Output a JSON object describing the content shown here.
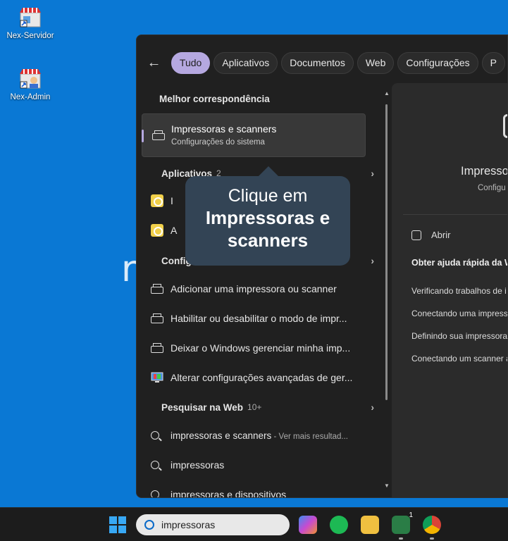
{
  "desktop": {
    "icons": [
      {
        "label": "Nex-Servidor"
      },
      {
        "label": "Nex-Admin"
      }
    ],
    "bg_letter": "r"
  },
  "search_panel": {
    "filters": [
      {
        "label": "Tudo",
        "active": true
      },
      {
        "label": "Aplicativos"
      },
      {
        "label": "Documentos"
      },
      {
        "label": "Web"
      },
      {
        "label": "Configurações"
      },
      {
        "label": "P"
      }
    ],
    "best_match": {
      "section": "Melhor correspondência",
      "title": "Impressoras e scanners",
      "subtitle": "Configurações do sistema"
    },
    "apps": {
      "section": "Aplicativos",
      "count": "2",
      "items": [
        "I",
        "A"
      ]
    },
    "settings": {
      "section": "Config",
      "items": [
        "Adicionar uma impressora ou scanner",
        "Habilitar ou desabilitar o modo de impr...",
        "Deixar o Windows gerenciar minha imp...",
        "Alterar configurações avançadas de ger..."
      ]
    },
    "web": {
      "section": "Pesquisar na Web",
      "count": "10+",
      "items": [
        {
          "bold": "impressoras e scanners",
          "muted": " - Ver mais resultad..."
        },
        {
          "bold": "impressoras",
          "muted": ""
        },
        {
          "bold": "impressoras e dispositivos",
          "muted": ""
        }
      ]
    },
    "preview": {
      "title": "Impresso",
      "subtitle": "Configu",
      "open_label": "Abrir",
      "help_title": "Obter ajuda rápida da We",
      "links": [
        "Verificando trabalhos de i",
        "Conectando uma impress",
        "Definindo sua impressora",
        "Conectando um scanner a"
      ]
    }
  },
  "tooltip": {
    "line1": "Clique em",
    "line2": "Impressoras e",
    "line3": "scanners"
  },
  "taskbar": {
    "search_value": "impressoras",
    "chrome_badge": "1",
    "colors": {
      "start": "#38a8f4",
      "accent": "#b5a8e0"
    }
  }
}
